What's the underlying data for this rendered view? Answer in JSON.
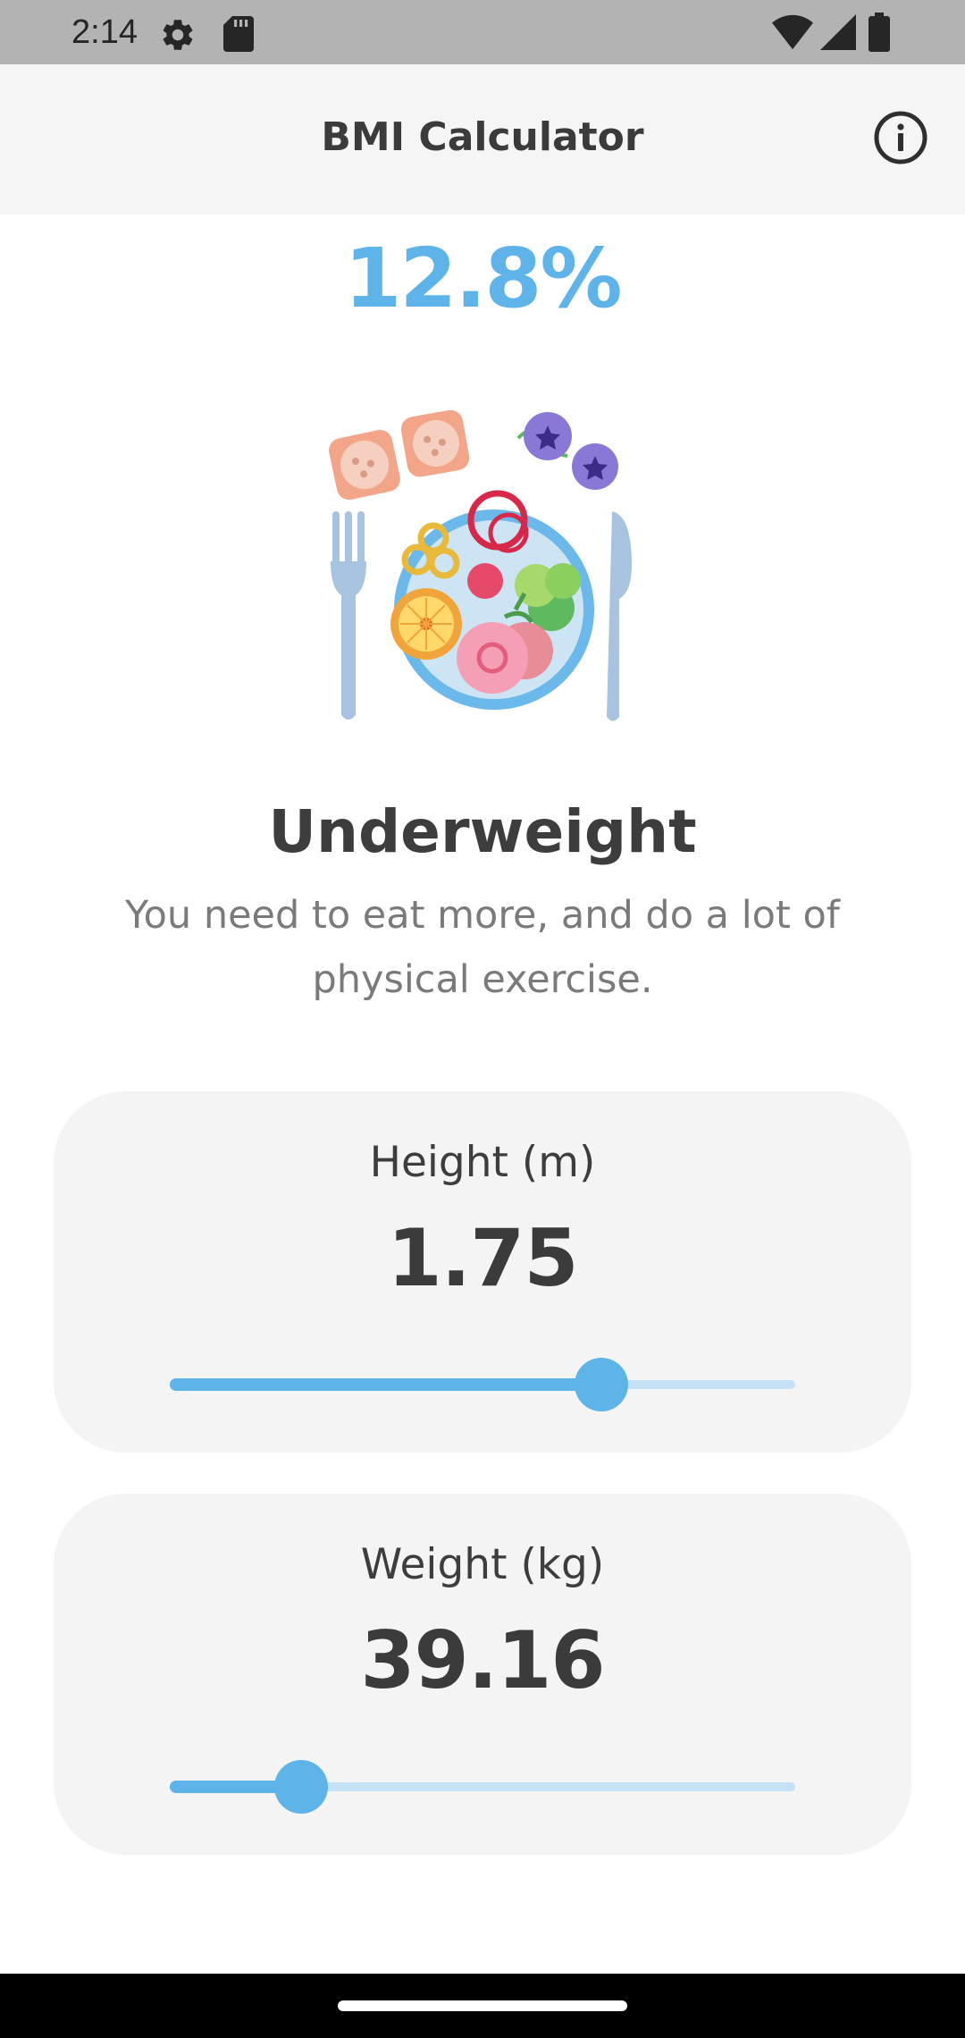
{
  "status_bar": {
    "time": "2:14",
    "icons": [
      "settings-gear-icon",
      "sd-card-icon",
      "wifi-icon",
      "cellular-signal-icon",
      "battery-icon"
    ]
  },
  "app_bar": {
    "title": "BMI Calculator",
    "info_icon": "info-circle-icon"
  },
  "result": {
    "bmi_value": "12.8%",
    "illustration": "food-plate-illustration",
    "category": "Underweight",
    "advice": "You need to eat more, and do a lot of physical exercise."
  },
  "height_card": {
    "label": "Height (m)",
    "value": "1.75",
    "slider_fraction": 0.69
  },
  "weight_card": {
    "label": "Weight (kg)",
    "value": "39.16",
    "slider_fraction": 0.21
  },
  "colors": {
    "accent": "#5eb3e8",
    "accent_light": "#c5e1f6",
    "card_background": "#f4f4f4",
    "app_bar_background": "#f5f5f5",
    "text_dark": "#3b3b3b",
    "text_muted": "#7a7a7a"
  }
}
